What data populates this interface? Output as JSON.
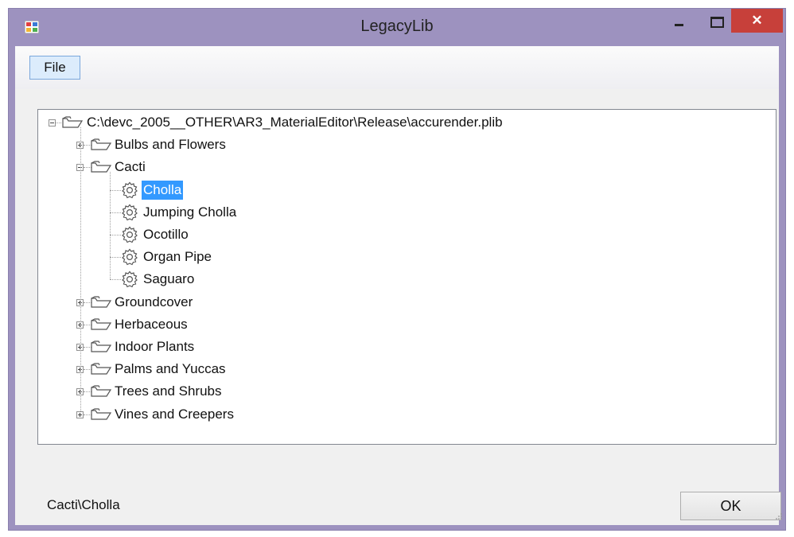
{
  "window": {
    "title": "LegacyLib",
    "close_glyph": "✕"
  },
  "menu": {
    "file": "File"
  },
  "tree": {
    "root": "C:\\devc_2005__OTHER\\AR3_MaterialEditor\\Release\\accurender.plib",
    "folders": [
      {
        "label": "Bulbs and Flowers",
        "expanded": false
      },
      {
        "label": "Cacti",
        "expanded": true,
        "children": [
          "Cholla",
          "Jumping Cholla",
          "Ocotillo",
          "Organ Pipe",
          "Saguaro"
        ]
      },
      {
        "label": "Groundcover",
        "expanded": false
      },
      {
        "label": "Herbaceous",
        "expanded": false
      },
      {
        "label": "Indoor Plants",
        "expanded": false
      },
      {
        "label": "Palms and Yuccas",
        "expanded": false
      },
      {
        "label": "Trees and Shrubs",
        "expanded": false
      },
      {
        "label": "Vines and Creepers",
        "expanded": false
      }
    ],
    "selected": "Cholla"
  },
  "status": {
    "path": "Cacti\\Cholla"
  },
  "buttons": {
    "ok": "OK"
  },
  "icons": {
    "app": "app-icon",
    "folder": "folder-open-icon",
    "material": "gear-icon",
    "expand": "plus-box-icon",
    "collapse": "minus-box-icon"
  },
  "colors": {
    "frame": "#9d92bf",
    "close": "#c7403a",
    "selection": "#3399ff",
    "client": "#f0f0f0"
  }
}
